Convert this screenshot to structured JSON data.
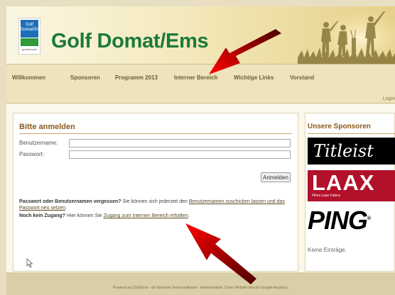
{
  "header": {
    "logo_text_line1": "Golf",
    "logo_text_line2": "Domat/Ems",
    "logo_sub": "graubünden",
    "site_title": "Golf Domat/Ems"
  },
  "nav": {
    "items": [
      {
        "label": "Willkommen"
      },
      {
        "label": "Sponsoren"
      },
      {
        "label": "Programm 2013"
      },
      {
        "label": "Interner Bereich"
      },
      {
        "label": "Wichtige Links"
      },
      {
        "label": "Vorstand"
      }
    ],
    "login_link": "Login"
  },
  "login": {
    "title": "Bitte anmelden",
    "username_label": "Benutzername:",
    "username_value": "",
    "password_label": "Passwort:",
    "password_value": "",
    "submit_label": "Anmelden"
  },
  "help": {
    "forgot_bold": "Passwort oder Benutzernamen vergessen?",
    "forgot_text": " Sie können sich jederzeit den ",
    "forgot_link": "Benutzernamen zuschicken lassen und das Passwort neu setzen",
    "forgot_end": ".",
    "noaccess_bold": "Noch kein Zugang?",
    "noaccess_text": " Hier können Sie ",
    "noaccess_link": "Zugang zum internen Bereich erhalten",
    "noaccess_end": "."
  },
  "sidebar": {
    "title": "Unsere Sponsoren",
    "sponsors": [
      {
        "name": "Titleist"
      },
      {
        "name": "LAAX",
        "sub": "Flims Laax Falera"
      },
      {
        "name": "PING",
        "sub": "®"
      }
    ],
    "empty_text": "Keine Einträge."
  },
  "footer": {
    "text": "Powered by ClubDesk - die führende Vereinssoftware - Administration. Diese Website benutzt Google Analytics."
  },
  "colors": {
    "title_green": "#1a7a3a",
    "heading_brown": "#8a5a1e",
    "arrow_red": "#e00000",
    "titleist_bg": "#000000",
    "laax_bg": "#b3102a"
  }
}
